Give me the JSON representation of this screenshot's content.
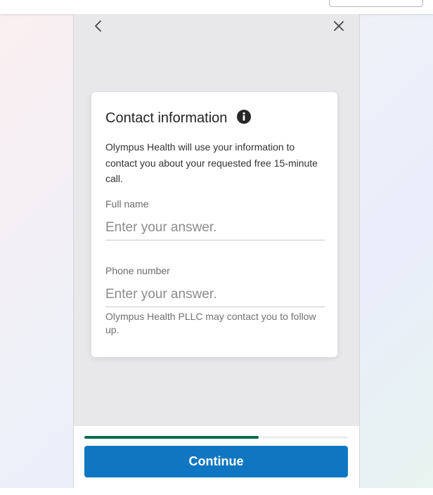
{
  "colors": {
    "panel_bg": "#e8e8eb",
    "progress": "#0c6b52",
    "primary_button": "#0f77c1"
  },
  "nav": {
    "back_icon": "chevron-left-icon",
    "close_icon": "close-icon"
  },
  "card": {
    "title": "Contact information",
    "info_icon": "info-icon",
    "description": "Olympus Health will use your information to contact you about your requested free 15-minute call."
  },
  "fields": [
    {
      "label": "Full name",
      "value": "",
      "placeholder": "Enter your answer."
    },
    {
      "label": "Phone number",
      "value": "",
      "placeholder": "Enter your answer.",
      "hint": "Olympus Health PLLC may contact you to follow up."
    }
  ],
  "footer": {
    "progress": 0.66,
    "continue_label": "Continue"
  }
}
